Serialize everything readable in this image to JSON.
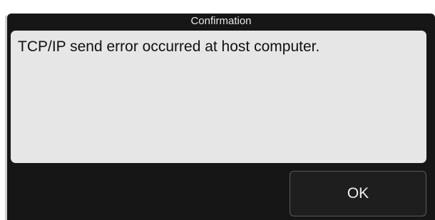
{
  "dialog": {
    "title": "Confirmation",
    "message": "TCP/IP send error occurred at host computer.",
    "ok_label": "OK"
  },
  "colors": {
    "dialog_background": "#161616",
    "message_background": "#e6e6e6",
    "button_background": "#1e1e1e",
    "button_border": "#5a5a5a"
  }
}
